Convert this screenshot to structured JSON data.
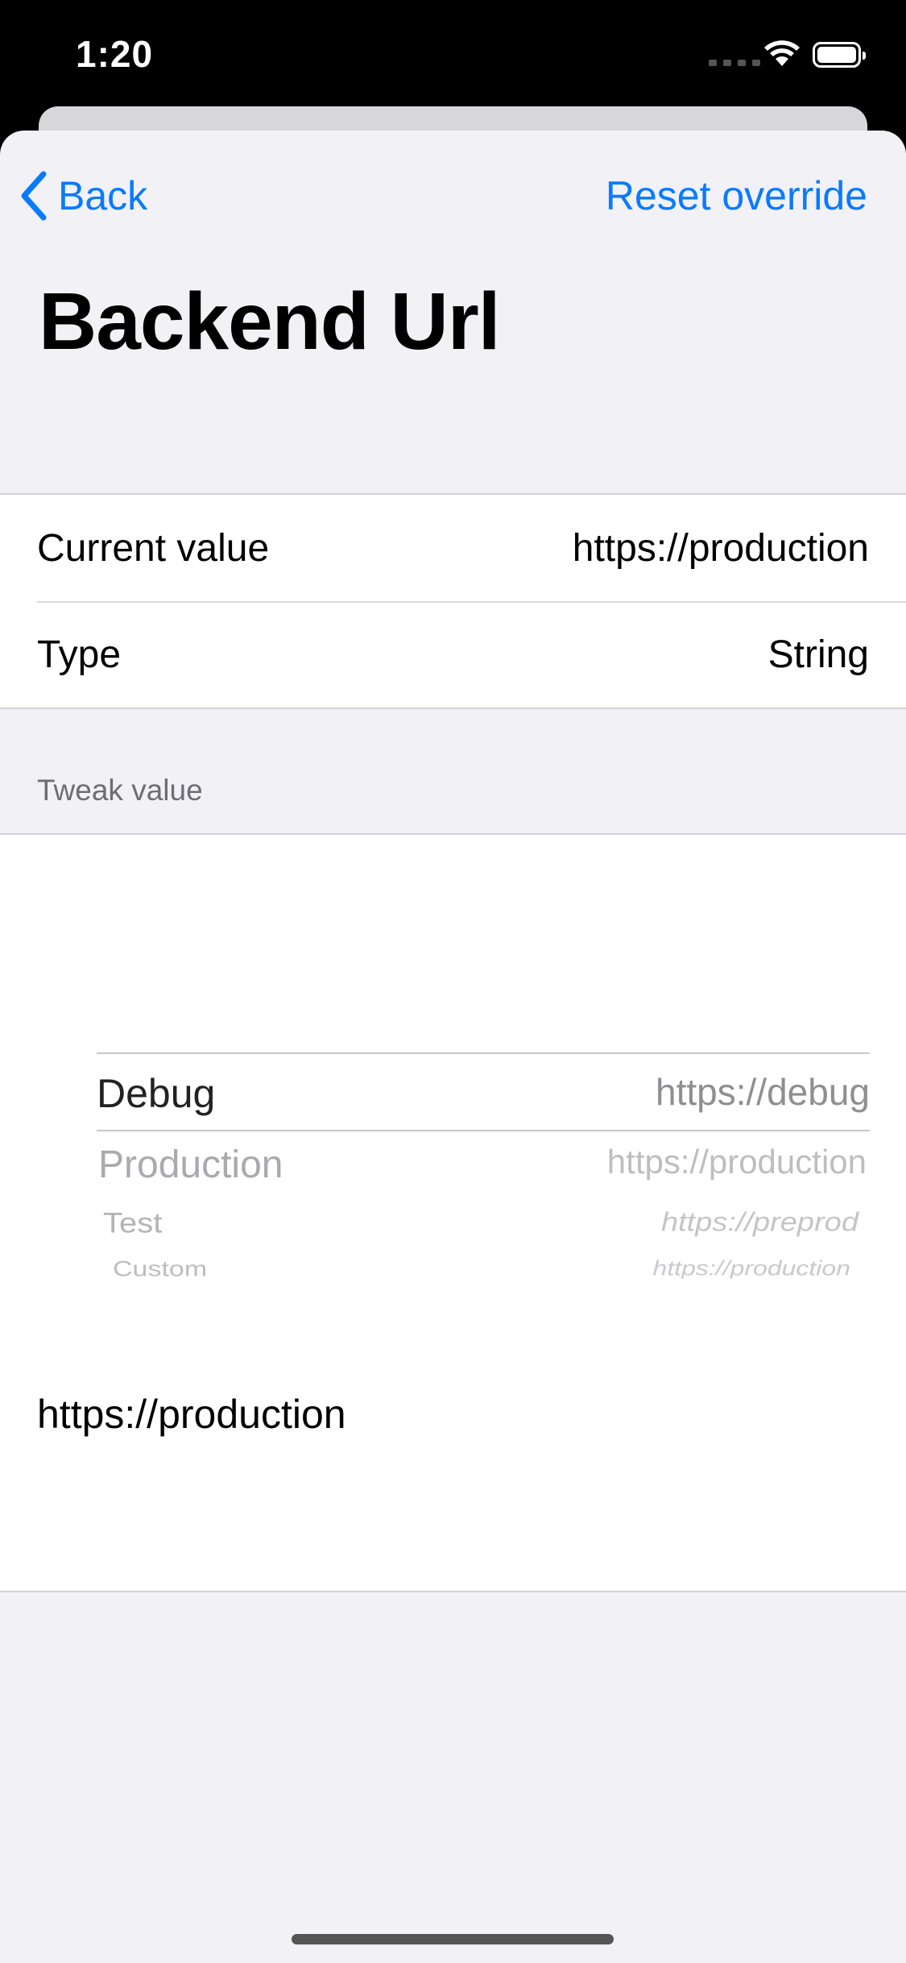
{
  "status_bar": {
    "time": "1:20"
  },
  "nav": {
    "back_label": "Back",
    "reset_label": "Reset override"
  },
  "page": {
    "title": "Backend Url"
  },
  "info_rows": [
    {
      "label": "Current value",
      "value": "https://production"
    },
    {
      "label": "Type",
      "value": "String"
    }
  ],
  "tweak_section": {
    "header": "Tweak value",
    "options": [
      {
        "name": "Debug",
        "url": "https://debug",
        "selected": true
      },
      {
        "name": "Production",
        "url": "https://production"
      },
      {
        "name": "Test",
        "url": "https://preprod"
      },
      {
        "name": "Custom",
        "url": "https://production"
      }
    ],
    "current_text": "https://production"
  },
  "colors": {
    "accent": "#0a7afe",
    "background": "#f1f1f6"
  }
}
